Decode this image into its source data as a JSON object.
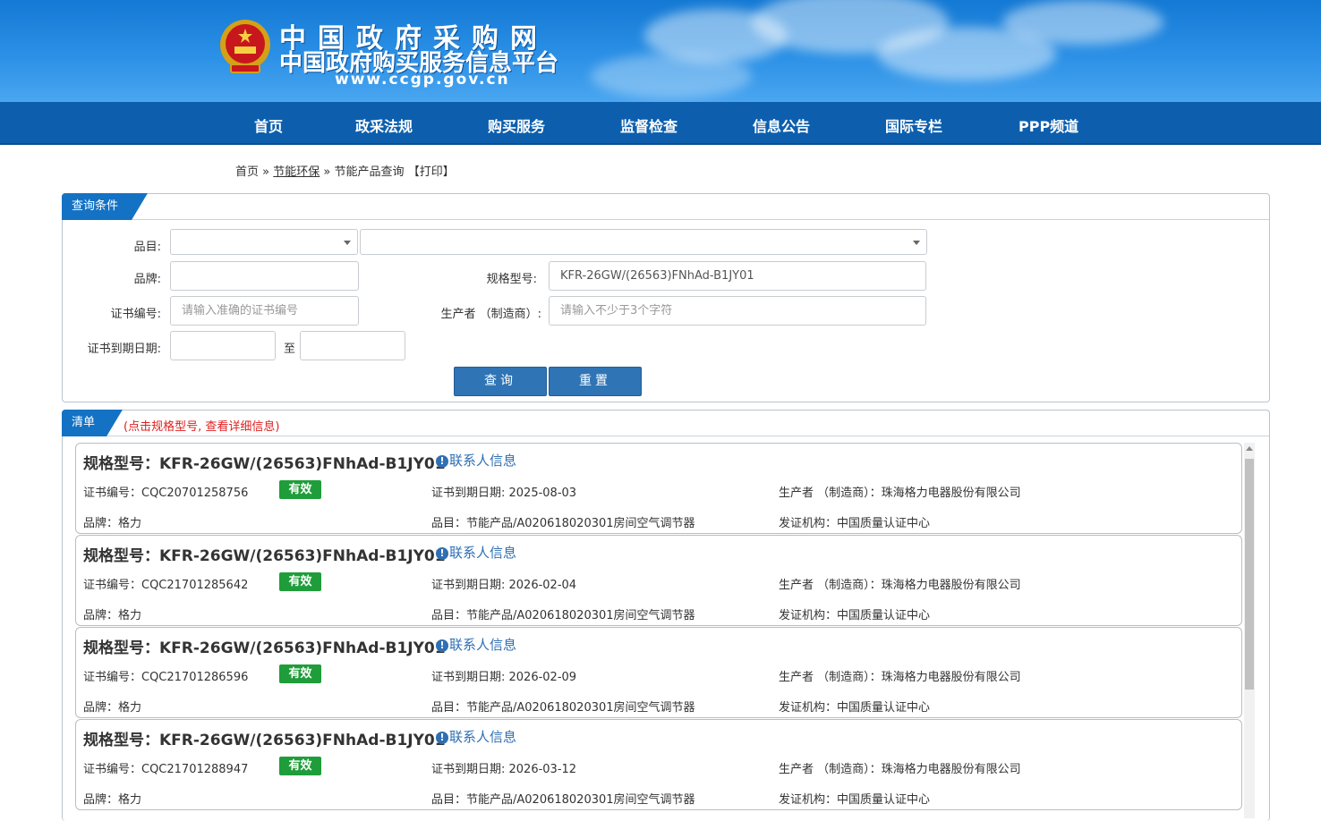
{
  "header": {
    "title": "中国政府采购网",
    "subtitle": "中国政府购买服务信息平台",
    "url": "www.ccgp.gov.cn"
  },
  "nav": [
    "首页",
    "政采法规",
    "购买服务",
    "监督检查",
    "信息公告",
    "国际专栏",
    "PPP频道"
  ],
  "breadcrumb": {
    "home": "首页",
    "sep1": "»",
    "section": "节能环保",
    "sep2": "»",
    "current": "节能产品查询",
    "print": "【打印】"
  },
  "query": {
    "tab": "查询条件",
    "category_label": "品目:",
    "category1": "",
    "category2": "",
    "brand_label": "品牌:",
    "brand_value": "",
    "model_label": "规格型号:",
    "model_value": "KFR-26GW/(26563)FNhAd-B1JY01",
    "cert_label": "证书编号:",
    "cert_placeholder": "请输入准确的证书编号",
    "maker_label": "生产者 （制造商）:",
    "maker_placeholder": "请输入不少于3个字符",
    "expire_label": "证书到期日期:",
    "to": "至",
    "search_btn": "查询",
    "reset_btn": "重置"
  },
  "list": {
    "tab": "清单",
    "hint": "(点击规格型号, 查看详细信息)",
    "contact_label": "联系人信息",
    "items": [
      {
        "title": "规格型号：KFR-26GW/(26563)FNhAd-B1JY01",
        "cert": "证书编号：CQC20701258756",
        "status": "有效",
        "expire": "证书到期日期: 2025-08-03",
        "maker": "生产者 （制造商）：珠海格力电器股份有限公司",
        "brand": "品牌：格力",
        "category": "品目：节能产品/A020618020301房间空气调节器",
        "issuer": "发证机构：中国质量认证中心"
      },
      {
        "title": "规格型号：KFR-26GW/(26563)FNhAd-B1JY01",
        "cert": "证书编号：CQC21701285642",
        "status": "有效",
        "expire": "证书到期日期: 2026-02-04",
        "maker": "生产者 （制造商）：珠海格力电器股份有限公司",
        "brand": "品牌：格力",
        "category": "品目：节能产品/A020618020301房间空气调节器",
        "issuer": "发证机构：中国质量认证中心"
      },
      {
        "title": "规格型号：KFR-26GW/(26563)FNhAd-B1JY01",
        "cert": "证书编号：CQC21701286596",
        "status": "有效",
        "expire": "证书到期日期: 2026-02-09",
        "maker": "生产者 （制造商）：珠海格力电器股份有限公司",
        "brand": "品牌：格力",
        "category": "品目：节能产品/A020618020301房间空气调节器",
        "issuer": "发证机构：中国质量认证中心"
      },
      {
        "title": "规格型号：KFR-26GW/(26563)FNhAd-B1JY01",
        "cert": "证书编号：CQC21701288947",
        "status": "有效",
        "expire": "证书到期日期: 2026-03-12",
        "maker": "生产者 （制造商）：珠海格力电器股份有限公司",
        "brand": "品牌：格力",
        "category": "品目：节能产品/A020618020301房间空气调节器",
        "issuer": "发证机构：中国质量认证中心"
      }
    ]
  },
  "colors": {
    "brand": "#0d5fae",
    "badge": "#1f9d3a",
    "hint": "#e02020",
    "button": "#2f74b5"
  },
  "icons": [
    "national-emblem-icon",
    "info-icon",
    "dropdown-arrow-icon"
  ]
}
